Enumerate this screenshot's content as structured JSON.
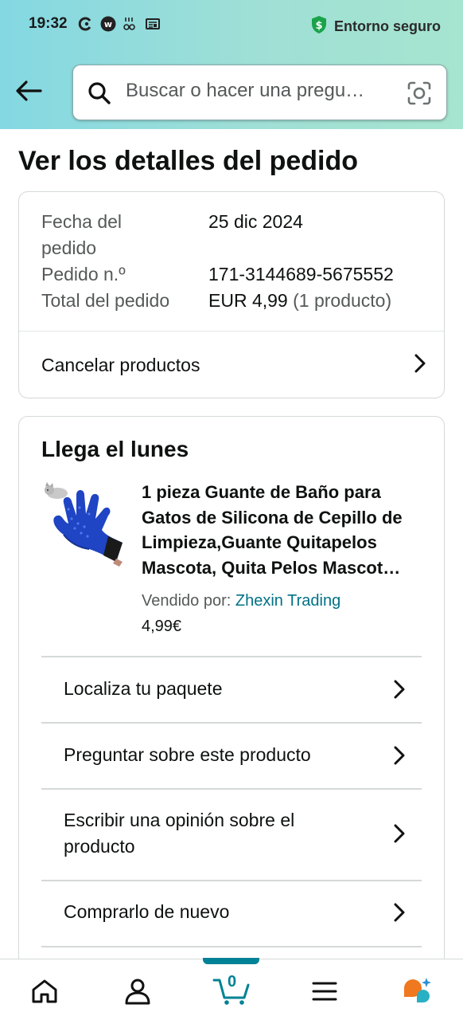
{
  "status_bar": {
    "time": "19:32",
    "secure_label": "Entorno seguro",
    "icons": [
      "refresh-c-icon",
      "w-circle-icon",
      "grid-dots-icon",
      "news-icon"
    ]
  },
  "search": {
    "placeholder": "Buscar o hacer una pregu…"
  },
  "page": {
    "title": "Ver los detalles del pedido"
  },
  "order_info": {
    "date_label_line1": "Fecha del",
    "date_label_line2": "pedido",
    "date_value": "25 dic 2024",
    "number_label": "Pedido n.º",
    "number_value": "171-3144689-5675552",
    "total_label": "Total del pedido",
    "total_value": "EUR 4,99",
    "total_count": "(1 producto)",
    "cancel_label": "Cancelar productos"
  },
  "shipment": {
    "arrival": "Llega el lunes",
    "product_title": "1 pieza Guante de Baño para Gatos de Silicona de Cepillo de Limpieza,Guante Quitapelos Mascota, Quita Pelos Mascot…",
    "sold_by_label": "Vendido por:",
    "seller": "Zhexin Trading",
    "price": "4,99€",
    "actions": [
      {
        "label": "Localiza tu paquete"
      },
      {
        "label": "Preguntar sobre este producto"
      },
      {
        "label": "Escribir una opinión sobre el producto"
      },
      {
        "label": "Comprarlo de nuevo"
      }
    ]
  },
  "bottom_nav": {
    "cart_count": "0",
    "items": [
      "home-icon",
      "account-icon",
      "cart-icon",
      "menu-icon",
      "assistant-icon"
    ]
  },
  "colors": {
    "accent": "#008296",
    "link": "#007185",
    "secure_green": "#1aa34a"
  }
}
